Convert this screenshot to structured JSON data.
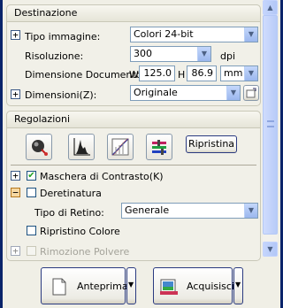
{
  "destinazione": {
    "header": "Destinazione",
    "tipo_immagine_label": "Tipo immagine:",
    "tipo_immagine_value": "Colori 24-bit",
    "risoluzione_label": "Risoluzione:",
    "risoluzione_value": "300",
    "dpi_label": "dpi",
    "dimensione_label": "Dimensione Documento:",
    "w_label": "W",
    "w_value": "125.0",
    "h_label": "H",
    "h_value": "86.9",
    "unit_value": "mm",
    "dimensioni_label": "Dimensioni(Z):",
    "dimensioni_value": "Originale"
  },
  "regolazioni": {
    "header": "Regolazioni",
    "ripristina_label": "Ripristina",
    "maschera_label": "Maschera di Contrasto(K)",
    "maschera_checked": "✔",
    "deretinatura_label": "Deretinatura",
    "tipo_retino_label": "Tipo di Retino:",
    "tipo_retino_value": "Generale",
    "ripristino_colore_label": "Ripristino Colore",
    "rimozione_polvere_label": "Rimozione Polvere"
  },
  "footer": {
    "anteprima_label": "Anteprima",
    "acquisisci_label": "Acquisisci"
  },
  "colors": {
    "window_bg": "#f0efe6",
    "border_blue": "#0a246a",
    "check_green": "#21a121"
  }
}
